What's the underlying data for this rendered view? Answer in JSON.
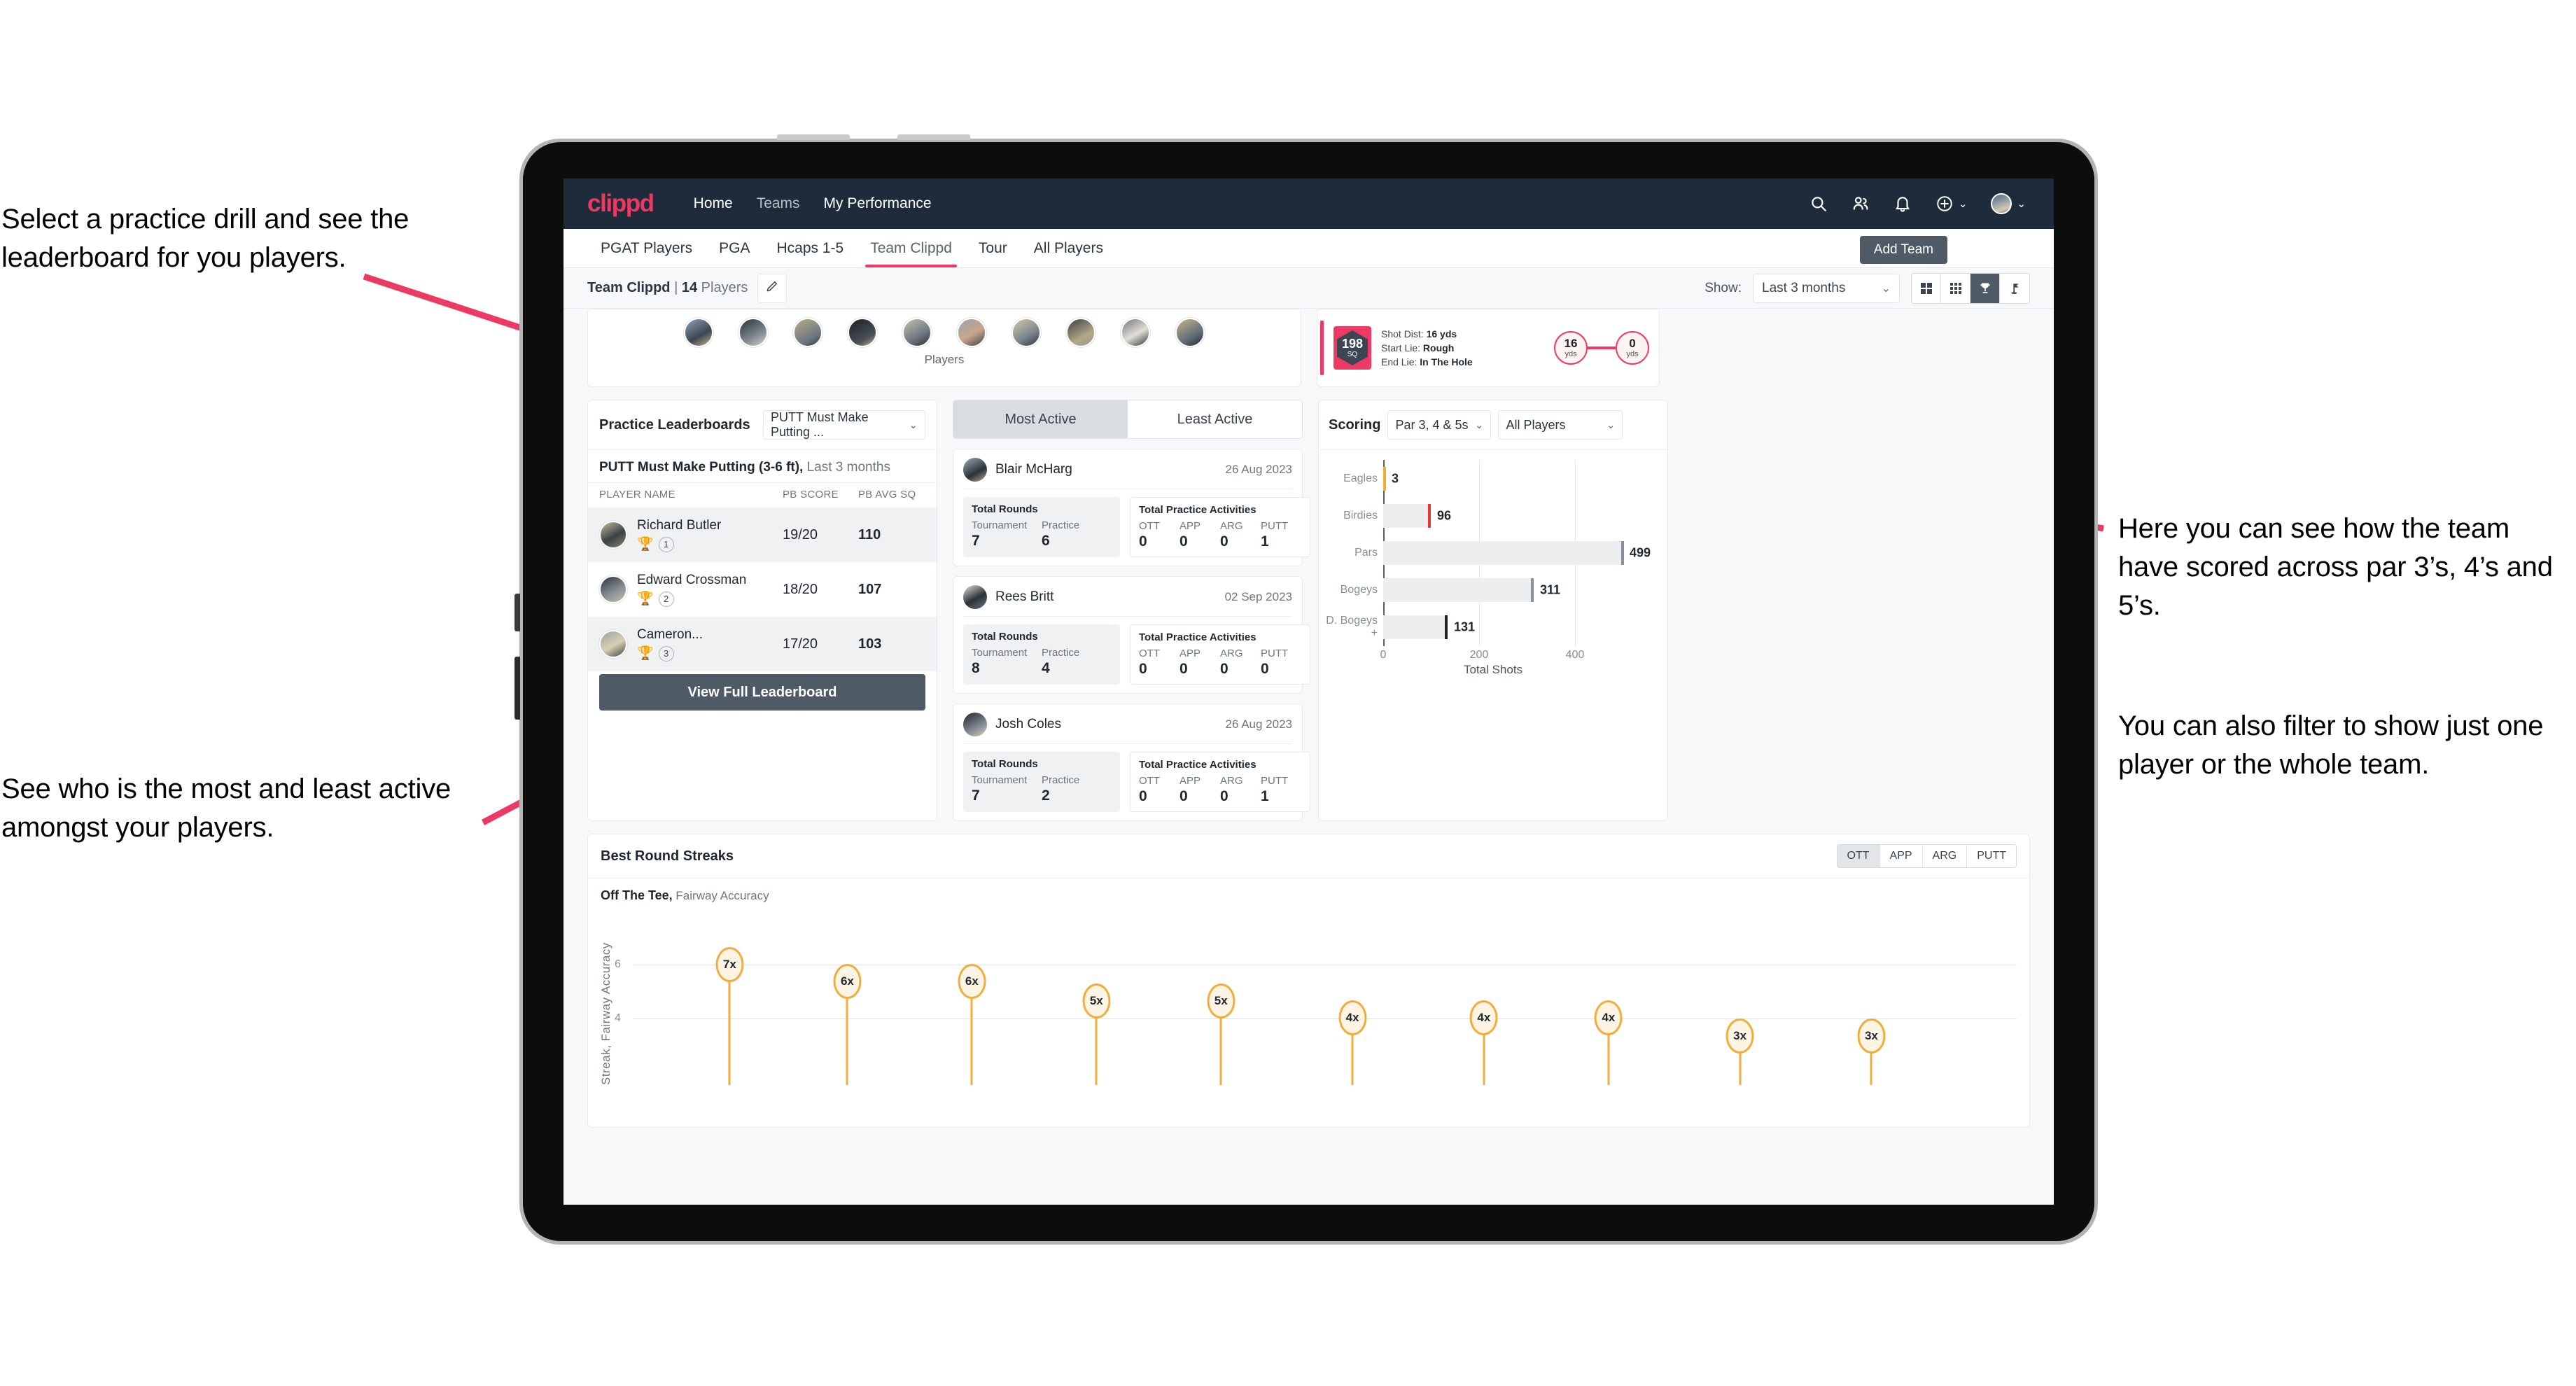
{
  "annotations": {
    "left_top": "Select a practice drill and see the leaderboard for you players.",
    "left_bottom": "See who is the most and least active amongst your players.",
    "right_top": "Here you can see how the team have scored across par 3’s, 4’s and 5’s.",
    "right_bottom": "You can also filter to show just one player or the whole team."
  },
  "navbar": {
    "logo": "clippd",
    "links": [
      {
        "label": "Home",
        "active": true
      },
      {
        "label": "Teams",
        "active": false
      },
      {
        "label": "My Performance",
        "active": true
      }
    ],
    "icons": [
      "search-icon",
      "people-icon",
      "bell-icon",
      "plus-circle-icon",
      "avatar"
    ]
  },
  "subnav": {
    "tabs": [
      {
        "label": "PGAT Players",
        "active": false
      },
      {
        "label": "PGA",
        "active": false
      },
      {
        "label": "Hcaps 1-5",
        "active": false
      },
      {
        "label": "Team Clippd",
        "active": true
      },
      {
        "label": "Tour",
        "active": false
      },
      {
        "label": "All Players",
        "active": false
      }
    ],
    "add_team_label": "Add Team"
  },
  "toolbar": {
    "team_name": "Team Clippd",
    "separator": "|",
    "player_count": "14",
    "players_word": "Players",
    "edit_icon": "pencil-icon",
    "show_label": "Show:",
    "range_value": "Last 3 months",
    "view_buttons": [
      {
        "name": "grid-large-icon",
        "active": false
      },
      {
        "name": "grid-small-icon",
        "active": false
      },
      {
        "name": "trophy-icon",
        "active": true
      },
      {
        "name": "golf-flag-icon",
        "active": false
      }
    ]
  },
  "players_card": {
    "caption": "Players",
    "avatar_count": 10
  },
  "shot_card": {
    "sq_value": "198",
    "sq_unit": "SQ",
    "lines": [
      {
        "label": "Shot Dist:",
        "value": "16 yds"
      },
      {
        "label": "Start Lie:",
        "value": "Rough"
      },
      {
        "label": "End Lie:",
        "value": "In The Hole"
      }
    ],
    "start_dist": "16",
    "start_unit": "yds",
    "end_dist": "0",
    "end_unit": "yds"
  },
  "leaderboard": {
    "title": "Practice Leaderboards",
    "drill_select": "PUTT Must Make Putting ...",
    "subtitle_bold": "PUTT Must Make Putting (3-6 ft),",
    "subtitle_muted": "Last 3 months",
    "columns": [
      "PLAYER NAME",
      "PB SCORE",
      "PB AVG SQ"
    ],
    "rows": [
      {
        "name": "Richard Butler",
        "trophy": "gold",
        "rank": "1",
        "pb_score": "19/20",
        "pb_avg_sq": "110"
      },
      {
        "name": "Edward Crossman",
        "trophy": "silver",
        "rank": "2",
        "pb_score": "18/20",
        "pb_avg_sq": "107"
      },
      {
        "name": "Cameron...",
        "trophy": "bronze",
        "rank": "3",
        "pb_score": "17/20",
        "pb_avg_sq": "103"
      }
    ],
    "button_label": "View Full Leaderboard"
  },
  "activity": {
    "tabs": [
      {
        "label": "Most Active",
        "active": true
      },
      {
        "label": "Least Active",
        "active": false
      }
    ],
    "rounds_title": "Total Rounds",
    "rounds_keys": [
      "Tournament",
      "Practice"
    ],
    "activities_title": "Total Practice Activities",
    "activities_keys": [
      "OTT",
      "APP",
      "ARG",
      "PUTT"
    ],
    "cards": [
      {
        "name": "Blair McHarg",
        "date": "26 Aug 2023",
        "rounds": [
          "7",
          "6"
        ],
        "activities": [
          "0",
          "0",
          "0",
          "1"
        ]
      },
      {
        "name": "Rees Britt",
        "date": "02 Sep 2023",
        "rounds": [
          "8",
          "4"
        ],
        "activities": [
          "0",
          "0",
          "0",
          "0"
        ]
      },
      {
        "name": "Josh Coles",
        "date": "26 Aug 2023",
        "rounds": [
          "7",
          "2"
        ],
        "activities": [
          "0",
          "0",
          "0",
          "1"
        ]
      }
    ]
  },
  "scoring": {
    "title": "Scoring",
    "par_filter": "Par 3, 4 & 5s",
    "player_filter": "All Players"
  },
  "streaks": {
    "title": "Best Round Streaks",
    "toggle": [
      {
        "label": "OTT",
        "active": true
      },
      {
        "label": "APP",
        "active": false
      },
      {
        "label": "ARG",
        "active": false
      },
      {
        "label": "PUTT",
        "active": false
      }
    ],
    "subtitle_bold": "Off The Tee,",
    "subtitle_muted": "Fairway Accuracy"
  },
  "colors": {
    "brand_pink": "#ec3a64",
    "navbar_dark": "#1e2b3a",
    "button_slate": "#4e5a66",
    "streak_amber": "#f0ad3c",
    "bar_grey": "#eceef0"
  },
  "chart_data": [
    {
      "type": "bar",
      "orientation": "horizontal",
      "title": "Scoring",
      "categories": [
        "Eagles",
        "Birdies",
        "Pars",
        "Bogeys",
        "D. Bogeys +"
      ],
      "values": [
        3,
        96,
        499,
        311,
        131
      ],
      "cap_colors": [
        "#f0ad3c",
        "#e03a3a",
        "#8a9099",
        "#8a9099",
        "#1f2630"
      ],
      "xlabel": "Total Shots",
      "ylabel": "",
      "xlim": [
        0,
        520
      ],
      "xticks": [
        0,
        200,
        400
      ],
      "grid": true,
      "legend": "none"
    },
    {
      "type": "scatter",
      "subtype": "lollipop",
      "title": "Best Round Streaks",
      "series_name": "Off The Tee, Fairway Accuracy",
      "ylabel": "Streak, Fairway Accuracy",
      "xlabel": "",
      "yticks": [
        4,
        6
      ],
      "ylim": [
        0,
        8
      ],
      "values": [
        7,
        6,
        6,
        5,
        5,
        4,
        4,
        4,
        3,
        3
      ],
      "labels": [
        "7x",
        "6x",
        "6x",
        "5x",
        "5x",
        "4x",
        "4x",
        "4x",
        "3x",
        "3x"
      ],
      "grid": true,
      "legend": "none"
    }
  ]
}
